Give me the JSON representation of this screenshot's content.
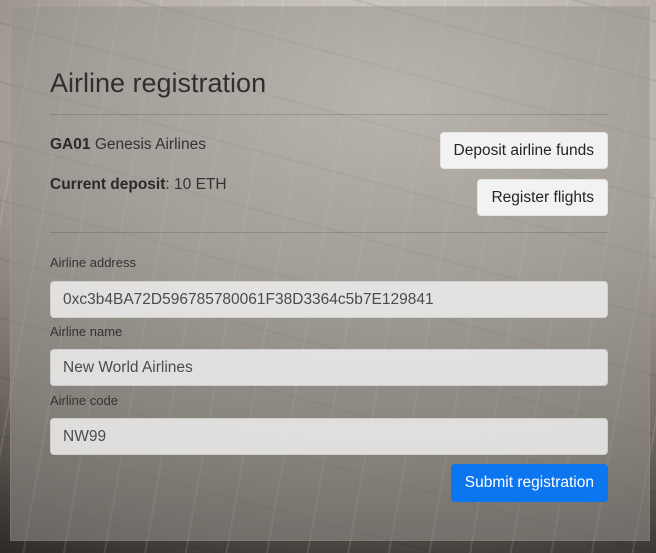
{
  "page_title": "Airline registration",
  "current_airline": {
    "code": "GA01",
    "name": "Genesis Airlines",
    "deposit_label": "Current deposit",
    "deposit_value": ": 10 ETH"
  },
  "buttons": {
    "deposit": "Deposit airline funds",
    "register_flights": "Register flights",
    "submit": "Submit registration"
  },
  "form": {
    "address_label": "Airline address",
    "address_value": "0xc3b4BA72D596785780061F38D3364c5b7E129841",
    "name_label": "Airline name",
    "name_value": "New World Airlines",
    "code_label": "Airline code",
    "code_value": "NW99"
  },
  "colors": {
    "primary": "#0b76f0"
  }
}
